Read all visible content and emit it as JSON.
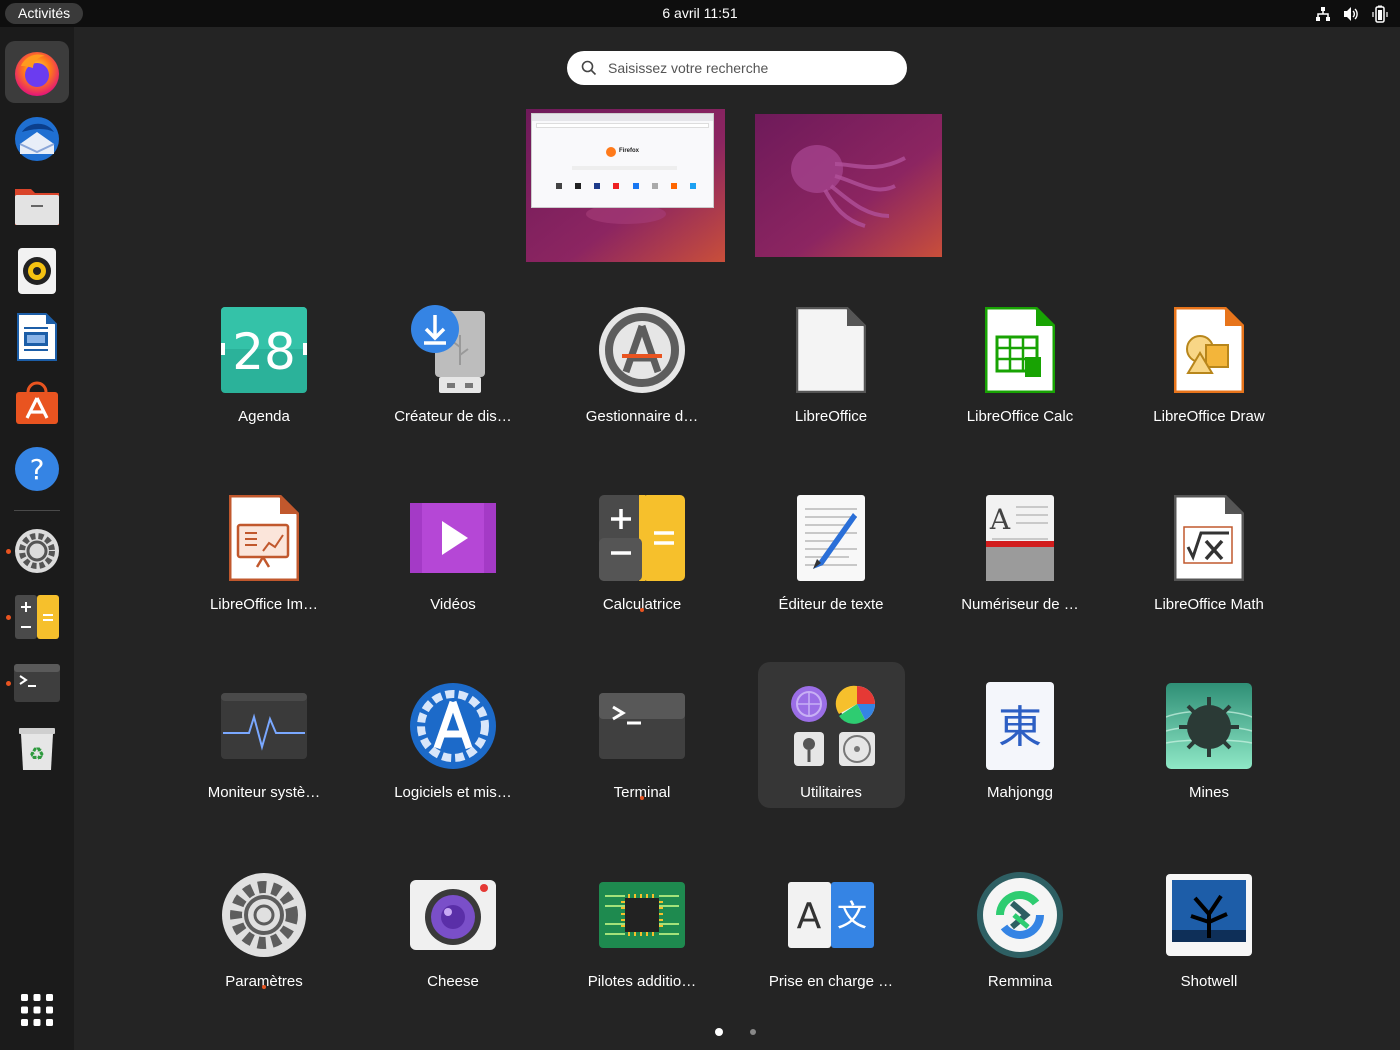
{
  "topbar": {
    "activities": "Activités",
    "clock": "6 avril  11:51",
    "tray_icons": [
      "network-icon",
      "volume-icon",
      "battery-icon"
    ]
  },
  "search": {
    "placeholder": "Saisissez votre recherche"
  },
  "dock": {
    "items": [
      "firefox",
      "thunderbird",
      "files",
      "rhythmbox",
      "libreoffice-writer",
      "ubuntu-software",
      "help",
      "settings",
      "calculator",
      "terminal",
      "trash"
    ],
    "show_apps_icon": "app-grid-icon"
  },
  "apps": [
    {
      "label": "Agenda",
      "icon": "calendar-icon",
      "day": "28"
    },
    {
      "label": "Créateur de dis…",
      "icon": "usb-creator-icon"
    },
    {
      "label": "Gestionnaire d…",
      "icon": "update-manager-icon"
    },
    {
      "label": "LibreOffice",
      "icon": "libreoffice-icon"
    },
    {
      "label": "LibreOffice Calc",
      "icon": "libreoffice-calc-icon"
    },
    {
      "label": "LibreOffice Draw",
      "icon": "libreoffice-draw-icon"
    },
    {
      "label": "LibreOffice Im…",
      "icon": "libreoffice-impress-icon"
    },
    {
      "label": "Vidéos",
      "icon": "videos-icon"
    },
    {
      "label": "Calculatrice",
      "icon": "calculator-icon",
      "running": true
    },
    {
      "label": "Éditeur de texte",
      "icon": "text-editor-icon"
    },
    {
      "label": "Numériseur de …",
      "icon": "scanner-icon"
    },
    {
      "label": "LibreOffice Math",
      "icon": "libreoffice-math-icon"
    },
    {
      "label": "Moniteur systè…",
      "icon": "system-monitor-icon"
    },
    {
      "label": "Logiciels et mis…",
      "icon": "software-updates-icon"
    },
    {
      "label": "Terminal",
      "icon": "terminal-icon",
      "running": true
    },
    {
      "label": "Utilitaires",
      "icon": "utilities-folder-icon",
      "folder": true
    },
    {
      "label": "Mahjongg",
      "icon": "mahjongg-icon",
      "glyph": "東"
    },
    {
      "label": "Mines",
      "icon": "mines-icon"
    },
    {
      "label": "Paramètres",
      "icon": "settings-icon",
      "running": true
    },
    {
      "label": "Cheese",
      "icon": "cheese-icon"
    },
    {
      "label": "Pilotes additio…",
      "icon": "drivers-icon"
    },
    {
      "label": "Prise en charge …",
      "icon": "language-support-icon",
      "glyph_a": "A",
      "glyph_b": "文"
    },
    {
      "label": "Remmina",
      "icon": "remmina-icon"
    },
    {
      "label": "Shotwell",
      "icon": "shotwell-icon"
    }
  ],
  "workspace_thumb": {
    "window_title": "Firefox"
  },
  "pager": {
    "pages": 2,
    "current": 1
  },
  "colors": {
    "accent": "#e95420",
    "background": "#242424",
    "dock": "#1b1b1b",
    "topbar": "#0e0e0e"
  }
}
